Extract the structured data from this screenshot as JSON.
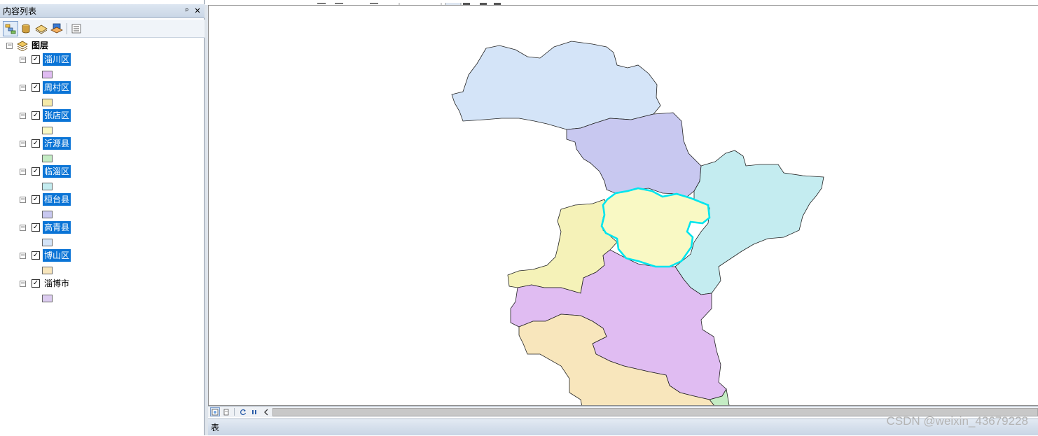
{
  "toc": {
    "title": "内容列表",
    "pin_label": "ᵖ",
    "close_label": "✕",
    "root_label": "图层",
    "layers": [
      {
        "name": "淄川区",
        "checked": true,
        "selected": true,
        "color": "#e0bcf2"
      },
      {
        "name": "周村区",
        "checked": true,
        "selected": true,
        "color": "#f5eaa8"
      },
      {
        "name": "张店区",
        "checked": true,
        "selected": true,
        "color": "#f9f9c4"
      },
      {
        "name": "沂源县",
        "checked": true,
        "selected": true,
        "color": "#c4ecc4"
      },
      {
        "name": "临淄区",
        "checked": true,
        "selected": true,
        "color": "#c4ecf0"
      },
      {
        "name": "桓台县",
        "checked": true,
        "selected": true,
        "color": "#c8c8f0"
      },
      {
        "name": "高青县",
        "checked": true,
        "selected": true,
        "color": "#d4e4f8"
      },
      {
        "name": "博山区",
        "checked": true,
        "selected": true,
        "color": "#f8e6bc"
      },
      {
        "name": "淄博市",
        "checked": true,
        "selected": false,
        "color": "#dcccf0"
      }
    ]
  },
  "map": {
    "highlight_color": "#00e5ee",
    "region_colors": {
      "gaoqing": "#d4e4f8",
      "huantai": "#c8c8f0",
      "linzi": "#c4ecf0",
      "zhoucun": "#f5f2b8",
      "zhangdian": "#f9f9c4",
      "zichuan": "#e0bcf2",
      "boshan": "#f8e6bc",
      "yiyuan": "#c4ecc4"
    }
  },
  "tablebar": {
    "label": "表"
  },
  "watermark": "CSDN @weixin_43679228"
}
